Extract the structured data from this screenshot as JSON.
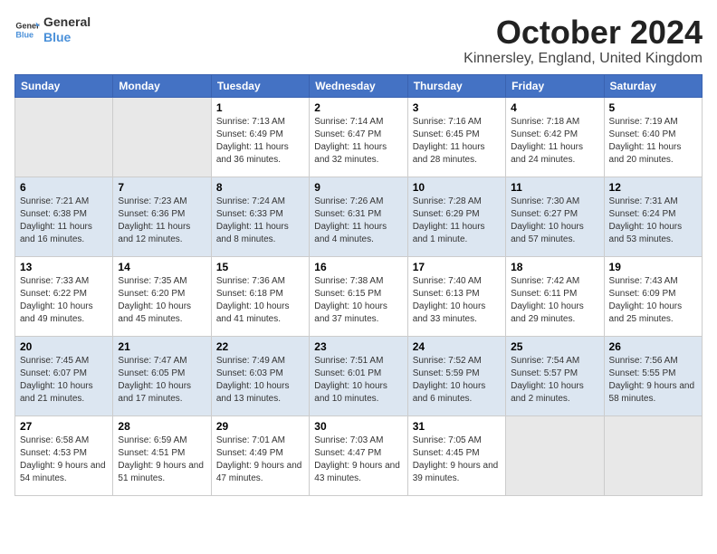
{
  "header": {
    "logo_line1": "General",
    "logo_line2": "Blue",
    "month_title": "October 2024",
    "location": "Kinnersley, England, United Kingdom"
  },
  "weekdays": [
    "Sunday",
    "Monday",
    "Tuesday",
    "Wednesday",
    "Thursday",
    "Friday",
    "Saturday"
  ],
  "weeks": [
    [
      {
        "day": "",
        "info": ""
      },
      {
        "day": "",
        "info": ""
      },
      {
        "day": "1",
        "info": "Sunrise: 7:13 AM\nSunset: 6:49 PM\nDaylight: 11 hours and 36 minutes."
      },
      {
        "day": "2",
        "info": "Sunrise: 7:14 AM\nSunset: 6:47 PM\nDaylight: 11 hours and 32 minutes."
      },
      {
        "day": "3",
        "info": "Sunrise: 7:16 AM\nSunset: 6:45 PM\nDaylight: 11 hours and 28 minutes."
      },
      {
        "day": "4",
        "info": "Sunrise: 7:18 AM\nSunset: 6:42 PM\nDaylight: 11 hours and 24 minutes."
      },
      {
        "day": "5",
        "info": "Sunrise: 7:19 AM\nSunset: 6:40 PM\nDaylight: 11 hours and 20 minutes."
      }
    ],
    [
      {
        "day": "6",
        "info": "Sunrise: 7:21 AM\nSunset: 6:38 PM\nDaylight: 11 hours and 16 minutes."
      },
      {
        "day": "7",
        "info": "Sunrise: 7:23 AM\nSunset: 6:36 PM\nDaylight: 11 hours and 12 minutes."
      },
      {
        "day": "8",
        "info": "Sunrise: 7:24 AM\nSunset: 6:33 PM\nDaylight: 11 hours and 8 minutes."
      },
      {
        "day": "9",
        "info": "Sunrise: 7:26 AM\nSunset: 6:31 PM\nDaylight: 11 hours and 4 minutes."
      },
      {
        "day": "10",
        "info": "Sunrise: 7:28 AM\nSunset: 6:29 PM\nDaylight: 11 hours and 1 minute."
      },
      {
        "day": "11",
        "info": "Sunrise: 7:30 AM\nSunset: 6:27 PM\nDaylight: 10 hours and 57 minutes."
      },
      {
        "day": "12",
        "info": "Sunrise: 7:31 AM\nSunset: 6:24 PM\nDaylight: 10 hours and 53 minutes."
      }
    ],
    [
      {
        "day": "13",
        "info": "Sunrise: 7:33 AM\nSunset: 6:22 PM\nDaylight: 10 hours and 49 minutes."
      },
      {
        "day": "14",
        "info": "Sunrise: 7:35 AM\nSunset: 6:20 PM\nDaylight: 10 hours and 45 minutes."
      },
      {
        "day": "15",
        "info": "Sunrise: 7:36 AM\nSunset: 6:18 PM\nDaylight: 10 hours and 41 minutes."
      },
      {
        "day": "16",
        "info": "Sunrise: 7:38 AM\nSunset: 6:15 PM\nDaylight: 10 hours and 37 minutes."
      },
      {
        "day": "17",
        "info": "Sunrise: 7:40 AM\nSunset: 6:13 PM\nDaylight: 10 hours and 33 minutes."
      },
      {
        "day": "18",
        "info": "Sunrise: 7:42 AM\nSunset: 6:11 PM\nDaylight: 10 hours and 29 minutes."
      },
      {
        "day": "19",
        "info": "Sunrise: 7:43 AM\nSunset: 6:09 PM\nDaylight: 10 hours and 25 minutes."
      }
    ],
    [
      {
        "day": "20",
        "info": "Sunrise: 7:45 AM\nSunset: 6:07 PM\nDaylight: 10 hours and 21 minutes."
      },
      {
        "day": "21",
        "info": "Sunrise: 7:47 AM\nSunset: 6:05 PM\nDaylight: 10 hours and 17 minutes."
      },
      {
        "day": "22",
        "info": "Sunrise: 7:49 AM\nSunset: 6:03 PM\nDaylight: 10 hours and 13 minutes."
      },
      {
        "day": "23",
        "info": "Sunrise: 7:51 AM\nSunset: 6:01 PM\nDaylight: 10 hours and 10 minutes."
      },
      {
        "day": "24",
        "info": "Sunrise: 7:52 AM\nSunset: 5:59 PM\nDaylight: 10 hours and 6 minutes."
      },
      {
        "day": "25",
        "info": "Sunrise: 7:54 AM\nSunset: 5:57 PM\nDaylight: 10 hours and 2 minutes."
      },
      {
        "day": "26",
        "info": "Sunrise: 7:56 AM\nSunset: 5:55 PM\nDaylight: 9 hours and 58 minutes."
      }
    ],
    [
      {
        "day": "27",
        "info": "Sunrise: 6:58 AM\nSunset: 4:53 PM\nDaylight: 9 hours and 54 minutes."
      },
      {
        "day": "28",
        "info": "Sunrise: 6:59 AM\nSunset: 4:51 PM\nDaylight: 9 hours and 51 minutes."
      },
      {
        "day": "29",
        "info": "Sunrise: 7:01 AM\nSunset: 4:49 PM\nDaylight: 9 hours and 47 minutes."
      },
      {
        "day": "30",
        "info": "Sunrise: 7:03 AM\nSunset: 4:47 PM\nDaylight: 9 hours and 43 minutes."
      },
      {
        "day": "31",
        "info": "Sunrise: 7:05 AM\nSunset: 4:45 PM\nDaylight: 9 hours and 39 minutes."
      },
      {
        "day": "",
        "info": ""
      },
      {
        "day": "",
        "info": ""
      }
    ]
  ]
}
